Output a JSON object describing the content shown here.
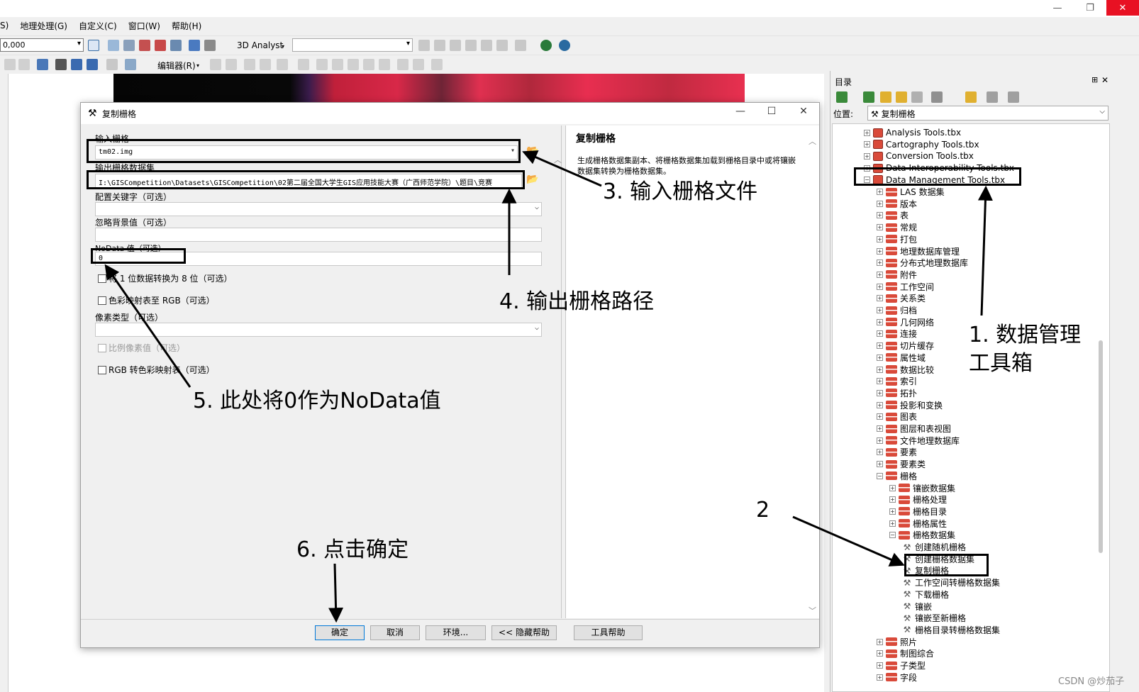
{
  "window": {
    "controls": [
      "—",
      "❐",
      "✕"
    ]
  },
  "menubar": {
    "items": [
      "S)",
      "地理处理(G)",
      "自定义(C)",
      "窗口(W)",
      "帮助(H)"
    ]
  },
  "toolbar": {
    "scale_value": "0,000",
    "analyst_label": "3D Analyst",
    "editor_label": "编辑器(R)"
  },
  "dialog": {
    "title": "复制栅格",
    "title_controls": [
      "—",
      "☐",
      "✕"
    ],
    "fields": {
      "input_raster_label": "输入栅格",
      "input_raster_value": "tm02.img",
      "output_dataset_label": "输出栅格数据集",
      "output_dataset_value": "I:\\GISCompetition\\Datasets\\GISCompetition\\02第二届全国大学生GIS应用技能大赛（广西师范学院）\\题目\\竞赛",
      "config_keyword_label": "配置关键字（可选）",
      "ignore_bg_label": "忽略背景值（可选）",
      "nodata_label": "NoData 值（可选）",
      "nodata_value": "0",
      "convert_1bit_label": "将 1 位数据转换为 8 位（可选）",
      "colormap_rgb_label": "色彩映射表至 RGB（可选）",
      "pixel_type_label": "像素类型（可选）",
      "scale_pixel_label": "比例像素值（可选）",
      "rgb_colormap_label": "RGB 转色彩映射表（可选）"
    },
    "help": {
      "title": "复制栅格",
      "body": "生成栅格数据集副本、将栅格数据集加载到栅格目录中或将镶嵌数据集转换为栅格数据集。"
    },
    "buttons": {
      "ok": "确定",
      "cancel": "取消",
      "env": "环境...",
      "hide_help": "<< 隐藏帮助",
      "tool_help": "工具帮助"
    }
  },
  "catalog": {
    "title": "目录",
    "pin": "⊞",
    "close": "✕",
    "location_label": "位置:",
    "location_value": "复制栅格",
    "toolboxes": [
      "Analysis Tools.tbx",
      "Cartography Tools.tbx",
      "Conversion Tools.tbx",
      "Data Interoperability Tools.tbx",
      "Data Management Tools.tbx"
    ],
    "dm_toolsets": [
      "LAS 数据集",
      "版本",
      "表",
      "常规",
      "打包",
      "地理数据库管理",
      "分布式地理数据库",
      "附件",
      "工作空间",
      "关系类",
      "归档",
      "几何网络",
      "连接",
      "切片缓存",
      "属性域",
      "数据比较",
      "索引",
      "拓扑",
      "投影和变换",
      "图表",
      "图层和表视图",
      "文件地理数据库",
      "要素",
      "要素类",
      "栅格"
    ],
    "raster_toolsets": [
      "镶嵌数据集",
      "栅格处理",
      "栅格目录",
      "栅格属性",
      "栅格数据集"
    ],
    "raster_dataset_tools": [
      "创建随机栅格",
      "创建栅格数据集",
      "复制栅格",
      "工作空间转栅格数据集",
      "下载栅格",
      "镶嵌",
      "镶嵌至新栅格",
      "栅格目录转栅格数据集"
    ],
    "after_raster": [
      "照片",
      "制图综合",
      "子类型",
      "字段"
    ]
  },
  "annotations": {
    "a1_line1": "1. 数据管理",
    "a1_line2": "工具箱",
    "a2": "2",
    "a3": "3. 输入栅格文件",
    "a4": "4. 输出栅格路径",
    "a5": "5. 此处将0作为NoData值",
    "a6": "6. 点击确定"
  },
  "watermark": "CSDN @炒茄子"
}
